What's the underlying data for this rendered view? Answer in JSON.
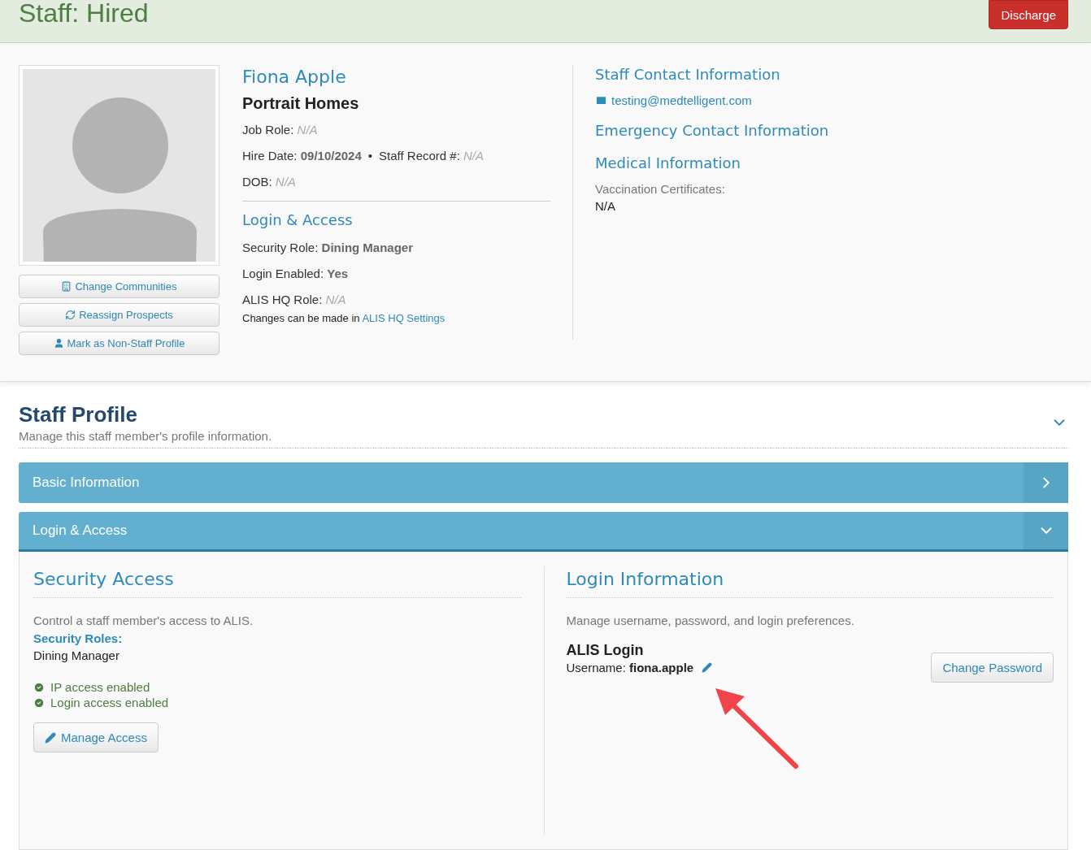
{
  "header": {
    "title": "Staff: Hired",
    "discharge_button": "Discharge"
  },
  "actions": [
    {
      "kind": "communities",
      "label": "Change Communities"
    },
    {
      "kind": "prospects",
      "label": "Reassign Prospects"
    },
    {
      "kind": "non_staff",
      "label": "Mark as Non-Staff Profile"
    }
  ],
  "profile": {
    "name": "Fiona Apple",
    "community": "Portrait Homes",
    "details": [
      {
        "fields": [
          {
            "label": "Job Role:",
            "value": "N/A",
            "missing": true
          }
        ]
      },
      {
        "separator": "•",
        "fields": [
          {
            "label": "Hire Date:",
            "value": "09/10/2024",
            "missing": false
          },
          {
            "label": "Staff Record #:",
            "value": "N/A",
            "missing": true
          }
        ]
      },
      {
        "fields": [
          {
            "label": "DOB:",
            "value": "N/A",
            "missing": true
          }
        ]
      }
    ]
  },
  "login_access": {
    "title": "Login & Access",
    "details": [
      {
        "label": "Security Role:",
        "value": "Dining Manager",
        "missing": false
      },
      {
        "label": "Login Enabled:",
        "value": "Yes",
        "missing": false
      },
      {
        "label": "ALIS HQ Role:",
        "value": "N/A",
        "missing": true
      }
    ],
    "note": "Changes can be made in",
    "note_link": "ALIS HQ Settings"
  },
  "contact": {
    "staff_title": "Staff Contact Information",
    "email": "testing@medtelligent.com",
    "emergency_title": "Emergency Contact Information",
    "medical_title": "Medical Information",
    "vaccination_label": "Vaccination Certificates:",
    "vaccination_value": "N/A"
  },
  "staff_profile": {
    "title": "Staff Profile",
    "subtitle": "Manage this staff member's profile information.",
    "expanded": true
  },
  "sections": [
    {
      "title": "Basic Information",
      "expanded": false
    },
    {
      "title": "Login & Access",
      "expanded": true
    }
  ],
  "security_access": {
    "title": "Security Access",
    "description": "Control a staff member's access to ALIS.",
    "roles_label": "Security Roles:",
    "role": "Dining Manager",
    "statuses": [
      {
        "label": "IP access enabled",
        "enabled": true
      },
      {
        "label": "Login access enabled",
        "enabled": true
      }
    ],
    "button": "Manage Access"
  },
  "login_information": {
    "title": "Login Information",
    "description": "Manage username, password, and login preferences.",
    "subtitle": "ALIS Login",
    "username_label": "Username:",
    "username": "fiona.apple",
    "button": "Change Password"
  },
  "annotation": {
    "kind": "arrow"
  }
}
